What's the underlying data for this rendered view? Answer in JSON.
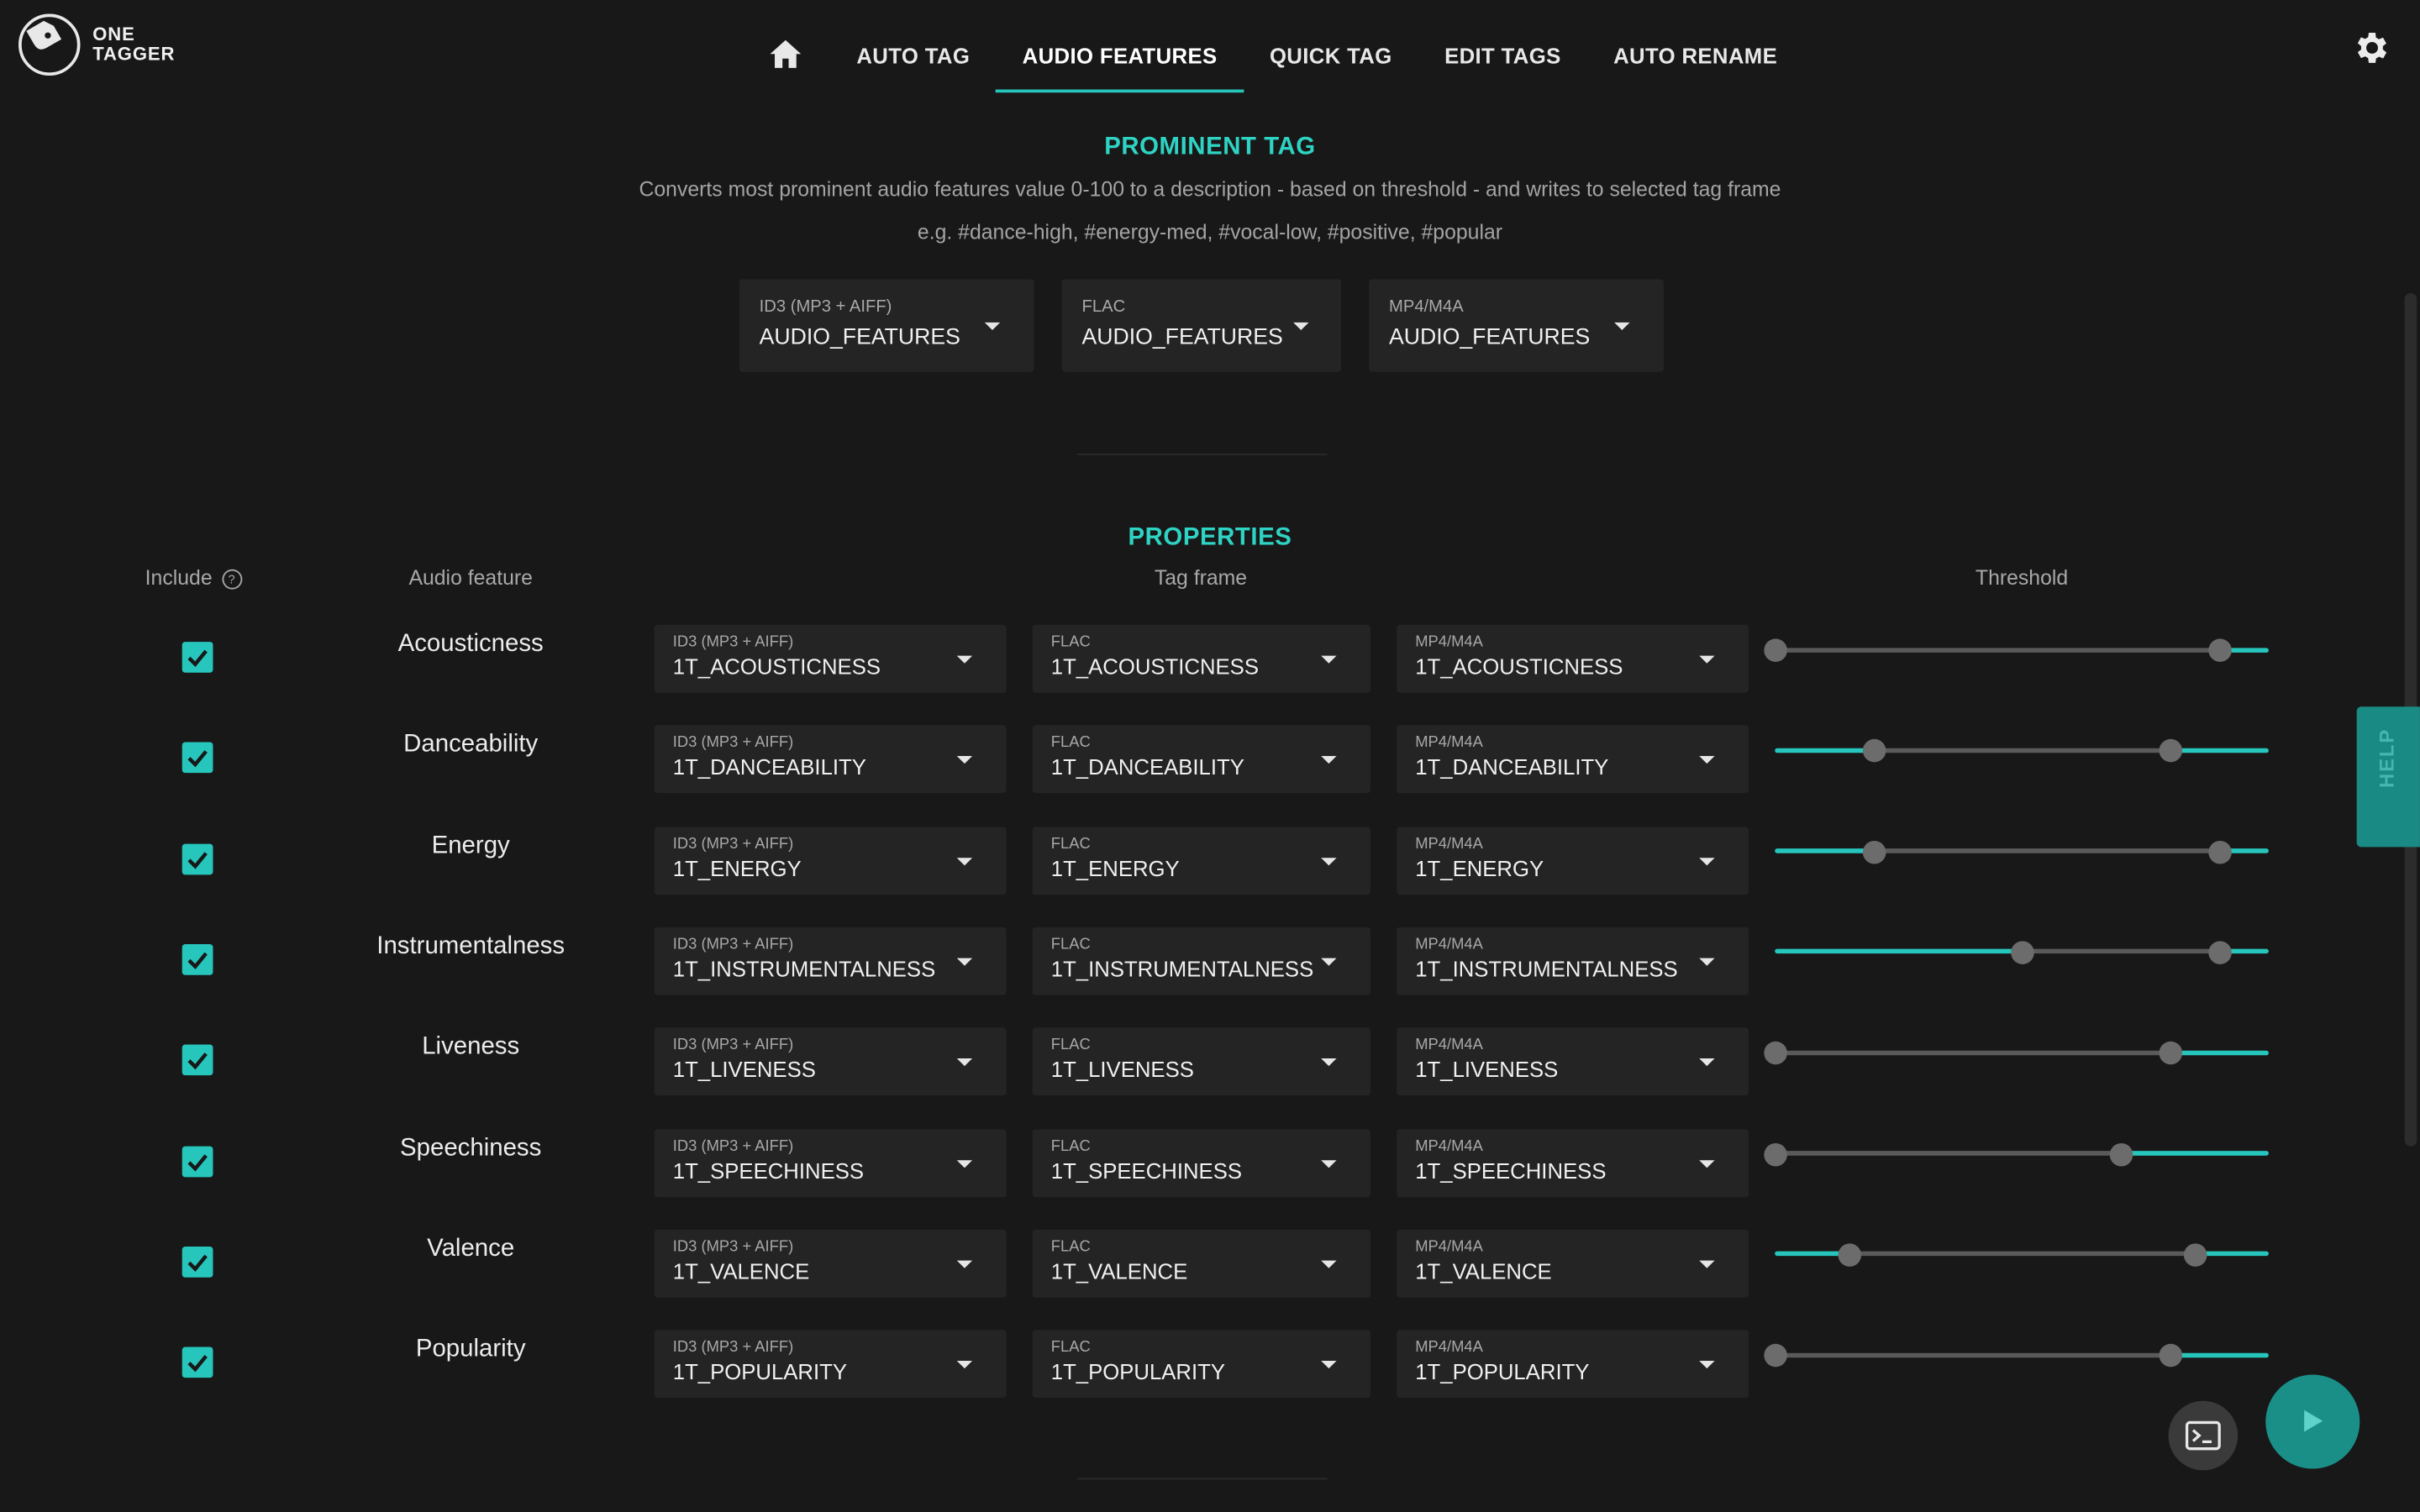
{
  "app": {
    "logo_line1": "ONE",
    "logo_line2": "TAGGER"
  },
  "nav": {
    "tabs": [
      {
        "label": "AUTO TAG"
      },
      {
        "label": "AUDIO FEATURES",
        "active": true
      },
      {
        "label": "QUICK TAG"
      },
      {
        "label": "EDIT TAGS"
      },
      {
        "label": "AUTO RENAME"
      }
    ]
  },
  "prominent": {
    "title": "PROMINENT TAG",
    "description": "Converts most prominent audio features value 0-100 to a description - based on threshold - and writes to selected tag frame",
    "example": "e.g. #dance-high, #energy-med, #vocal-low, #positive, #popular",
    "selects": [
      {
        "label": "ID3 (MP3 + AIFF)",
        "value": "AUDIO_FEATURES"
      },
      {
        "label": "FLAC",
        "value": "AUDIO_FEATURES"
      },
      {
        "label": "MP4/M4A",
        "value": "AUDIO_FEATURES"
      }
    ]
  },
  "properties": {
    "title": "PROPERTIES",
    "headers": {
      "include": "Include",
      "feature": "Audio feature",
      "tagframe": "Tag frame",
      "threshold": "Threshold"
    },
    "format_labels": [
      "ID3 (MP3 + AIFF)",
      "FLAC",
      "MP4/M4A"
    ],
    "rows": [
      {
        "feature": "Acousticness",
        "include": true,
        "tag": "1T_ACOUSTICNESS",
        "threshold": [
          0,
          90
        ]
      },
      {
        "feature": "Danceability",
        "include": true,
        "tag": "1T_DANCEABILITY",
        "threshold": [
          20,
          80
        ]
      },
      {
        "feature": "Energy",
        "include": true,
        "tag": "1T_ENERGY",
        "threshold": [
          20,
          90
        ]
      },
      {
        "feature": "Instrumentalness",
        "include": true,
        "tag": "1T_INSTRUMENTALNESS",
        "threshold": [
          50,
          90
        ]
      },
      {
        "feature": "Liveness",
        "include": true,
        "tag": "1T_LIVENESS",
        "threshold": [
          0,
          80
        ]
      },
      {
        "feature": "Speechiness",
        "include": true,
        "tag": "1T_SPEECHINESS",
        "threshold": [
          0,
          70
        ]
      },
      {
        "feature": "Valence",
        "include": true,
        "tag": "1T_VALENCE",
        "threshold": [
          15,
          85
        ]
      },
      {
        "feature": "Popularity",
        "include": true,
        "tag": "1T_POPULARITY",
        "threshold": [
          0,
          80
        ]
      }
    ]
  },
  "help": {
    "label": "HELP"
  },
  "colors": {
    "accent": "#26c6bd",
    "track_inactive": "#5a5a5a",
    "background": "#181818",
    "panel": "#242424"
  }
}
